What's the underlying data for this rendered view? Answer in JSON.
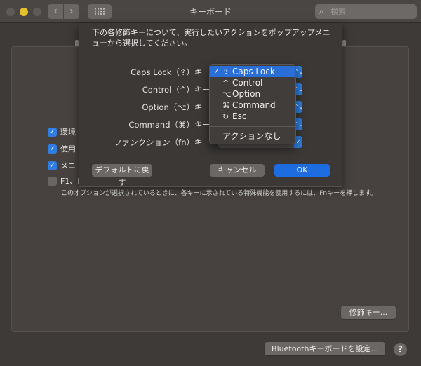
{
  "window": {
    "title": "キーボード",
    "search_placeholder": "検索",
    "nav_back_glyph": "‹",
    "nav_forward_glyph": "›",
    "search_icon_glyph": "⌕"
  },
  "preferences": {
    "checkboxes": [
      {
        "label": "環境",
        "checked": true,
        "check_glyph": "✓"
      },
      {
        "label": "使用",
        "checked": true,
        "check_glyph": "✓"
      },
      {
        "label": "メニ",
        "checked": true,
        "check_glyph": "✓"
      },
      {
        "label": "F1、F",
        "checked": false,
        "check_glyph": ""
      }
    ],
    "fn_hint": "このオプションが選択されているときに、各キーに示されている特殊機能を使用するには、Fnキーを押します。",
    "modifier_keys_button": "修飾キー...",
    "bluetooth_button": "Bluetoothキーボードを設定...",
    "help_button": "?"
  },
  "sheet": {
    "message": "下の各修飾キーについて、実行したいアクションをポップアップメニューから選択してください。",
    "rows": [
      {
        "label": "Caps Lock（⇪）キー",
        "arrow_glyph": "⌃⌄"
      },
      {
        "label": "Control（^）キー",
        "arrow_glyph": "⌃⌄"
      },
      {
        "label": "Option（⌥）キー",
        "arrow_glyph": "⌃⌄"
      },
      {
        "label": "Command（⌘）キー",
        "arrow_glyph": "⌃⌄"
      },
      {
        "label": "ファンクション（fn）キー",
        "arrow_glyph": "✓"
      }
    ],
    "buttons": {
      "default": "デフォルトに戻す",
      "cancel": "キャンセル",
      "ok": "OK"
    }
  },
  "popup_menu": {
    "selected_check": "✓",
    "items": [
      {
        "glyph": "⇪",
        "label": "Caps Lock",
        "selected": true
      },
      {
        "glyph": "^",
        "label": "Control",
        "selected": false
      },
      {
        "glyph": "⌥",
        "label": "Option",
        "selected": false
      },
      {
        "glyph": "⌘",
        "label": "Command",
        "selected": false
      },
      {
        "glyph": "↻",
        "label": "Esc",
        "selected": false
      }
    ],
    "no_action": "アクションなし"
  },
  "colors": {
    "accent": "#1d6ce0",
    "menu_highlight": "#2a6ed8",
    "minimize_button": "#e5c12f"
  }
}
